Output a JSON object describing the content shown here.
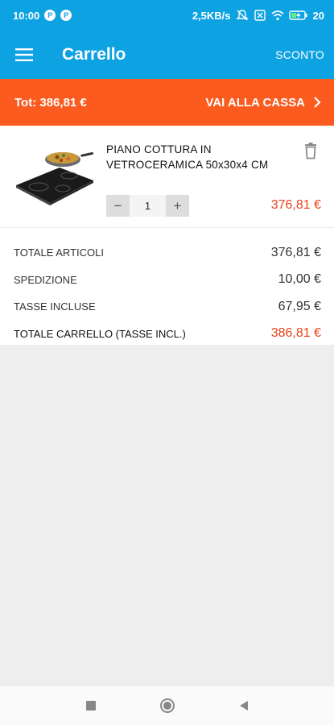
{
  "status_bar": {
    "time": "10:00",
    "badges": [
      "P",
      "P"
    ],
    "network_speed": "2,5KB/s",
    "battery": "20",
    "icons": [
      "mute-icon",
      "sim-icon",
      "wifi-icon",
      "battery-icon"
    ]
  },
  "app_bar": {
    "title": "Carrello",
    "discount_label": "SCONTO",
    "menu_icon": "hamburger-menu-icon"
  },
  "checkout_bar": {
    "total_text": "Tot: 386,81 €",
    "checkout_label": "VAI ALLA CASSA",
    "chevron_icon": "chevron-right-icon"
  },
  "cart": {
    "items": [
      {
        "name": "PIANO COTTURA IN VETROCERAMICA 50x30x4 CM",
        "quantity": "1",
        "price": "376,81 €",
        "decrement_label": "−",
        "increment_label": "+"
      }
    ]
  },
  "summary": {
    "rows": [
      {
        "label": "TOTALE ARTICOLI",
        "value": "376,81 €"
      },
      {
        "label": "SPEDIZIONE",
        "value": "10,00 €"
      },
      {
        "label": "TASSE INCLUSE",
        "value": "67,95 €"
      },
      {
        "label": "TOTALE CARRELLO (TASSE INCL.)",
        "value": "386,81 €"
      }
    ]
  },
  "colors": {
    "primary": "#0da2e2",
    "accent": "#fb5b1f",
    "price": "#e8431a"
  },
  "nav_bar": {
    "icons": [
      "recent-apps-icon",
      "home-icon",
      "back-icon"
    ]
  }
}
